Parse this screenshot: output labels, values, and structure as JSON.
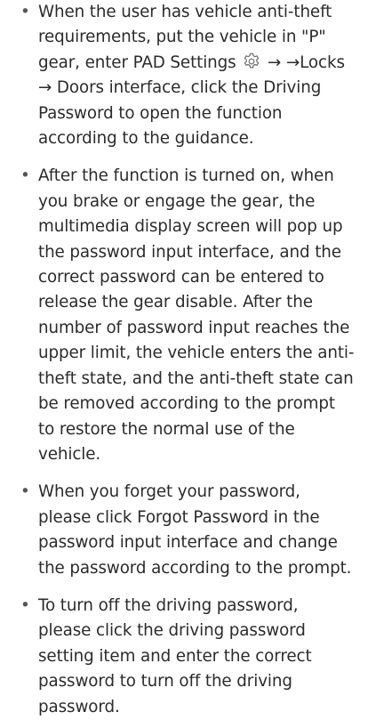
{
  "bullet_glyph": "•",
  "icons": {
    "settings": "gear-icon"
  },
  "items": [
    {
      "text_before_icon": "When the user has vehicle anti-theft requirements, put the vehicle in \"P\" gear, enter PAD Settings ",
      "text_after_icon": " → →Locks → Doors interface, click the Driving Password to open the function according to the guidance."
    },
    {
      "text": "After the function is turned on, when you brake or engage the gear, the multimedia display screen will pop up the password input interface, and the correct password can be entered to release the gear disable. After the number of password input reaches the upper limit, the vehicle enters the anti-theft state, and the anti-theft state can be removed according to the prompt to restore the normal use of the vehicle."
    },
    {
      "text": "When you forget your password, please click Forgot Password in the password input interface and change the password according to the prompt."
    },
    {
      "text": "To turn off the driving password, please click the driving password setting item and enter the correct password to turn off the driving password."
    }
  ]
}
